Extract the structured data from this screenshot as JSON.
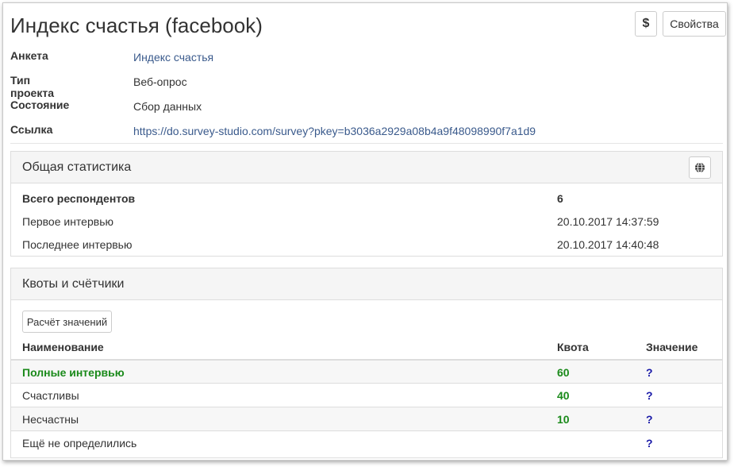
{
  "page_title": "Индекс счастья (facebook)",
  "toolbar": {
    "currency_label": "$",
    "properties_label": "Свойства"
  },
  "info": [
    {
      "label": "Анкета",
      "value": "Индекс счастья",
      "link": true
    },
    {
      "label": "Тип проекта",
      "value": "Веб-опрос",
      "link": false
    },
    {
      "label": "Состояние",
      "value": "Сбор данных",
      "link": false
    },
    {
      "label": "Ссылка",
      "value": "https://do.survey-studio.com/survey?pkey=b3036a2929a08b4a9f48098990f7a1d9",
      "link": true
    }
  ],
  "stats": {
    "title": "Общая статистика",
    "rows": [
      {
        "label": "Всего респондентов",
        "value": "6"
      },
      {
        "label": "Первое интервью",
        "value": "20.10.2017 14:37:59"
      },
      {
        "label": "Последнее интервью",
        "value": "20.10.2017 14:40:48"
      }
    ]
  },
  "quotas": {
    "title": "Квоты и счётчики",
    "calc_label": "Расчёт значений",
    "headers": {
      "name": "Наименование",
      "quota": "Квота",
      "value": "Значение"
    },
    "rows": [
      {
        "name": "Полные интервью",
        "quota": "60",
        "value": "?"
      },
      {
        "name": "Счастливы",
        "quota": "40",
        "value": "?"
      },
      {
        "name": "Несчастны",
        "quota": "10",
        "value": "?"
      },
      {
        "name": "Ещё не определились",
        "quota": "",
        "value": "?"
      }
    ]
  },
  "colors": {
    "link": "#3a5a8c",
    "quota_green": "#1a8a1a",
    "value_blue": "#1a1aa8"
  }
}
